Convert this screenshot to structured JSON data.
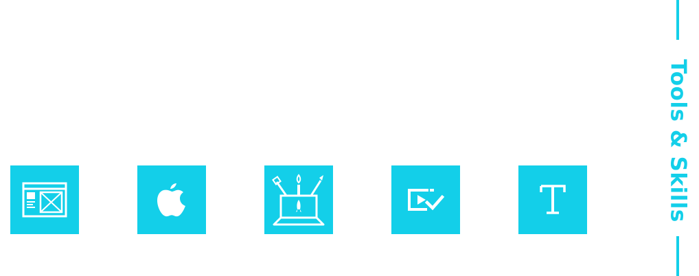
{
  "section": {
    "title": "Tools & Skills"
  },
  "colors": {
    "accent": "#13cfe9",
    "background": "#ffffff",
    "icon": "#ffffff"
  },
  "tools": [
    {
      "icon": "wireframe-icon"
    },
    {
      "icon": "apple-icon"
    },
    {
      "icon": "laptop-design-tools-icon"
    },
    {
      "icon": "video-check-icon"
    },
    {
      "icon": "typography-icon"
    }
  ]
}
